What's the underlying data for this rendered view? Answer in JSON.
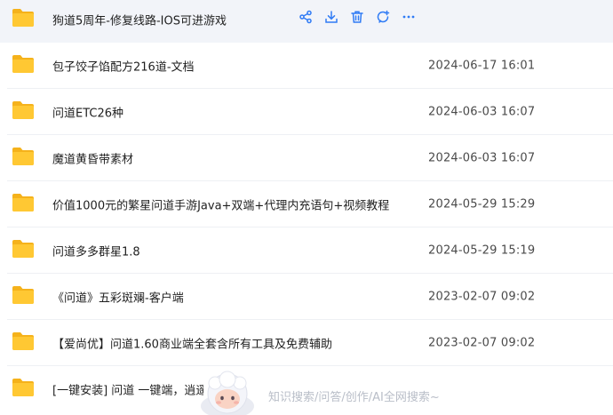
{
  "files": [
    {
      "name": "狗道5周年-修复线路-IOS可进游戏",
      "date": ""
    },
    {
      "name": "包子饺子馅配方216道-文档",
      "date": "2024-06-17 16:01"
    },
    {
      "name": "问道ETC26种",
      "date": "2024-06-03 16:07"
    },
    {
      "name": "魔道黄昏带素材",
      "date": "2024-06-03 16:07"
    },
    {
      "name": "价值1000元的繁星问道手游Java+双端+代理内充语句+视频教程",
      "date": "2024-05-29 15:29"
    },
    {
      "name": "问道多多群星1.8",
      "date": "2024-05-29 15:19"
    },
    {
      "name": "《问道》五彩斑斓-客户端",
      "date": "2023-02-07 09:02"
    },
    {
      "name": "【爱尚优】问道1.60商业端全套含所有工具及免费辅助",
      "date": "2023-02-07 09:02"
    },
    {
      "name": "[一键安装] 问道 一键端，逍遥",
      "date": ""
    }
  ],
  "hover_actions": [
    "share-icon",
    "download-icon",
    "delete-icon",
    "comment-icon",
    "more-icon"
  ],
  "floating_assistant": {
    "text": "知识搜索/问答/创作/AI全网搜索~"
  },
  "colors": {
    "folder": "#ffc833",
    "folder_tab": "#f5b21b",
    "action": "#2f7bf5",
    "hover_row": "#f2f4f9"
  }
}
